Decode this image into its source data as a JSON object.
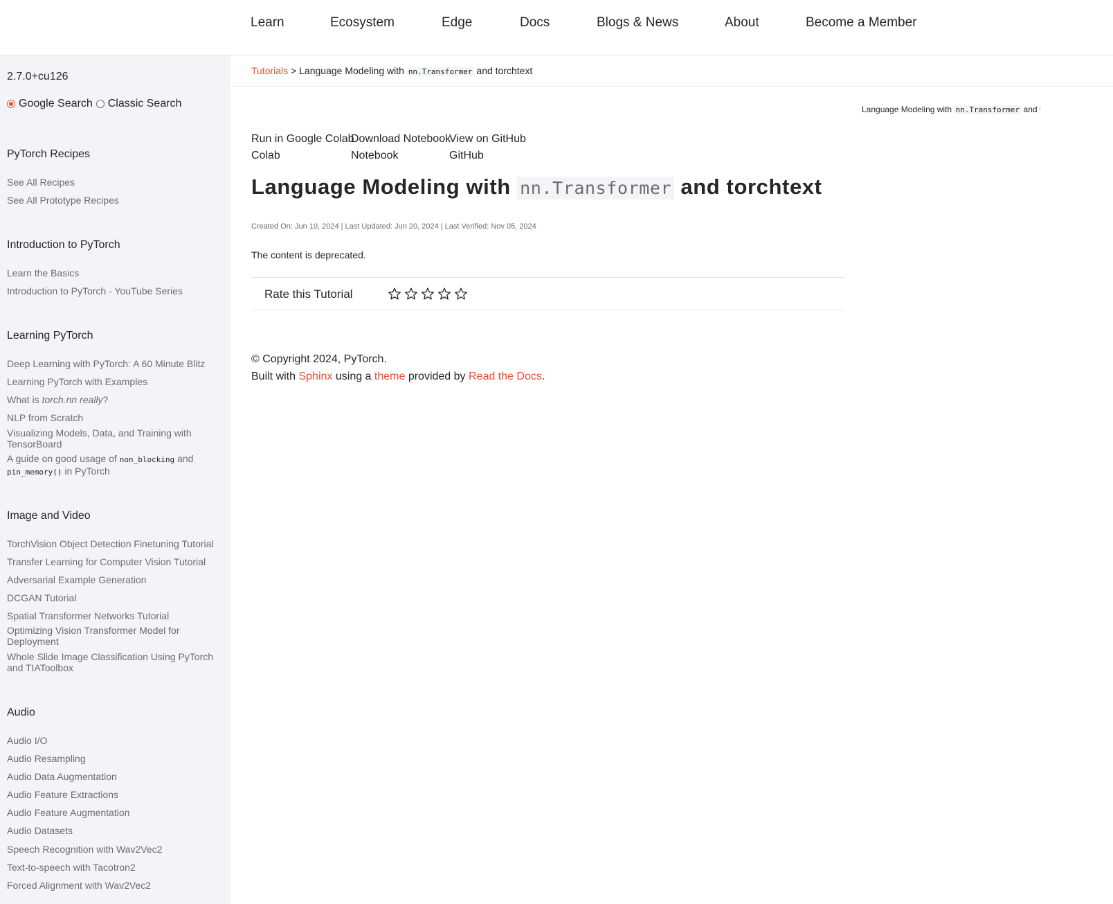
{
  "nav": {
    "items": [
      "Learn",
      "Ecosystem",
      "Edge",
      "Docs",
      "Blogs & News",
      "About",
      "Become a Member"
    ]
  },
  "sidebar": {
    "version": "2.7.0+cu126",
    "search": {
      "google_label": "Google Search",
      "classic_label": "Classic Search",
      "selected": "Google Search"
    },
    "sections": [
      {
        "title": "PyTorch Recipes",
        "items": [
          "See All Recipes",
          "See All Prototype Recipes"
        ]
      },
      {
        "title": "Introduction to PyTorch",
        "items": [
          "Learn the Basics",
          "Introduction to PyTorch - YouTube Series"
        ]
      },
      {
        "title": "Learning PyTorch",
        "items": [
          "Deep Learning with PyTorch: A 60 Minute Blitz",
          "Learning PyTorch with Examples",
          "What is torch.nn really?",
          "NLP from Scratch",
          "Visualizing Models, Data, and Training with TensorBoard",
          "A guide on good usage of non_blocking and pin_memory() in PyTorch"
        ],
        "what_is": {
          "pre": "What is ",
          "em": "torch.nn really",
          "post": "?"
        },
        "guide": {
          "pre": "A guide on good usage of ",
          "code1": "non_blocking",
          "mid": " and",
          "code2": "pin_memory()",
          "post": " in PyTorch"
        }
      },
      {
        "title": "Image and Video",
        "items": [
          "TorchVision Object Detection Finetuning Tutorial",
          "Transfer Learning for Computer Vision Tutorial",
          "Adversarial Example Generation",
          "DCGAN Tutorial",
          "Spatial Transformer Networks Tutorial",
          "Optimizing Vision Transformer Model for Deployment",
          "Whole Slide Image Classification Using PyTorch and TIAToolbox"
        ]
      },
      {
        "title": "Audio",
        "items": [
          "Audio I/O",
          "Audio Resampling",
          "Audio Data Augmentation",
          "Audio Feature Extractions",
          "Audio Feature Augmentation",
          "Audio Datasets",
          "Speech Recognition with Wav2Vec2",
          "Text-to-speech with Tacotron2",
          "Forced Alignment with Wav2Vec2"
        ]
      }
    ]
  },
  "breadcrumb": {
    "root": "Tutorials",
    "sep": ">",
    "current_pre": "Language Modeling with",
    "current_code": "nn.Transformer",
    "current_post": "and torchtext"
  },
  "toc": {
    "pre": "Language Modeling with",
    "code": "nn.Transformer",
    "post": "and torchtext"
  },
  "actions": {
    "colab": {
      "line1": "Run in Google Colab",
      "line2": "Colab"
    },
    "notebook": {
      "line1": "Download Notebook",
      "line2": "Notebook"
    },
    "github": {
      "line1": "View on GitHub",
      "line2": "GitHub"
    }
  },
  "page": {
    "title_pre": "Language Modeling with",
    "title_code": "nn.Transformer",
    "title_post": "and torchtext",
    "meta": "Created On: Jun 10, 2024 | Last Updated: Jun 20, 2024 | Last Verified: Nov 05, 2024",
    "body": "The content is deprecated."
  },
  "rating": {
    "label": "Rate this Tutorial",
    "max": 5,
    "value": 0
  },
  "footer": {
    "copyright": "© Copyright 2024, PyTorch.",
    "built_pre": "Built with",
    "sphinx": "Sphinx",
    "using": "using a",
    "theme": "theme",
    "provided": "provided by",
    "rtd": "Read the Docs",
    "end": "."
  },
  "colors": {
    "accent": "#ee4c2c",
    "sidebar_bg": "#f3f4f7",
    "text": "#262626",
    "muted": "#6c6c6d"
  }
}
